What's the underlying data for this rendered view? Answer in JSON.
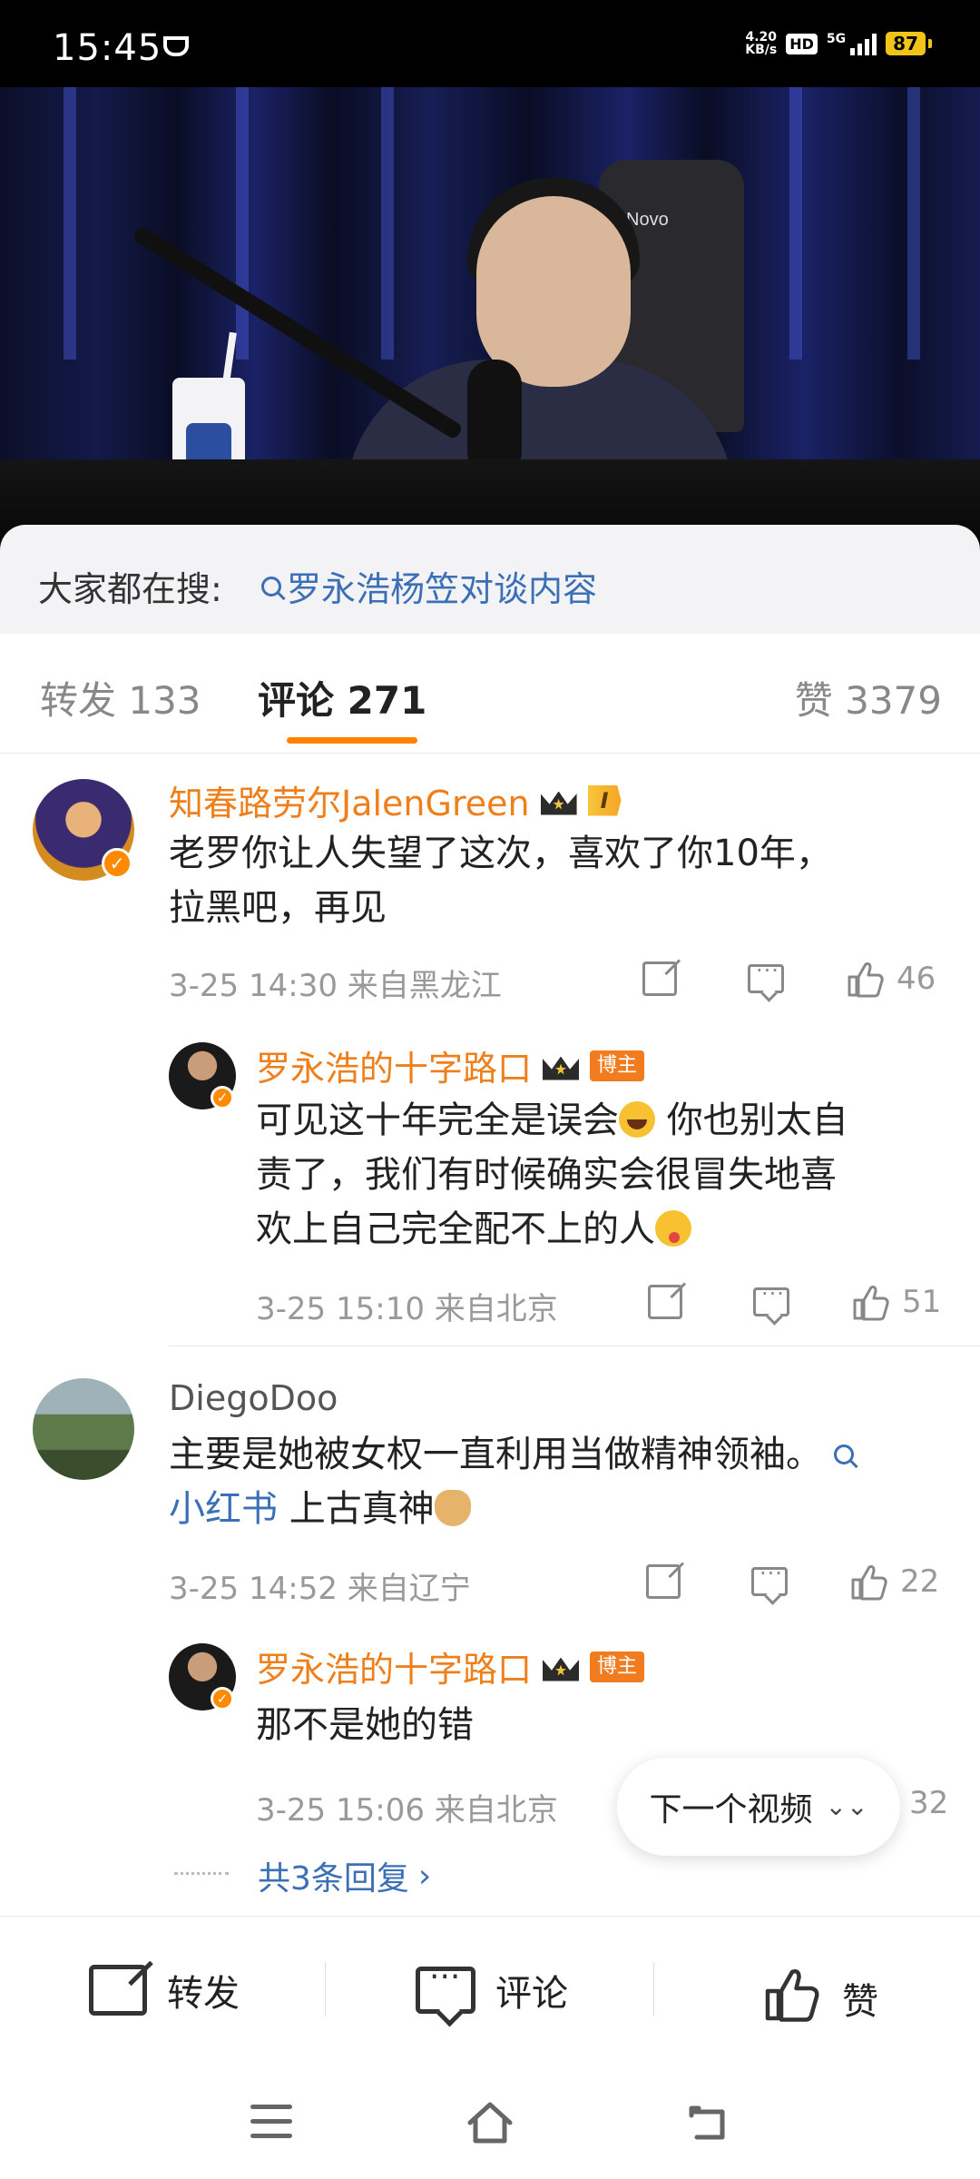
{
  "status_bar": {
    "time": "15:45",
    "net_speed_value": "4.20",
    "net_speed_unit": "KB/s",
    "hd": "HD",
    "network": "5G",
    "battery": "87"
  },
  "video": {
    "chair_brand": "Novo"
  },
  "search_suggest": {
    "label": "大家都在搜:",
    "query": "罗永浩杨笠对谈内容"
  },
  "tabs": {
    "repost": "转发 133",
    "comment": "评论 271",
    "likes": "赞 3379"
  },
  "comments": [
    {
      "username": "知春路劳尔JalenGreen",
      "level": "I",
      "text_line1": "老罗你让人失望了这次，喜欢了你10年，",
      "text_line2": "拉黑吧，再见",
      "meta": "3-25 14:30  来自黑龙江",
      "likes": "46",
      "reply": {
        "username": "罗永浩的十字路口",
        "badge": "博主",
        "text_line1": "可见这十年完全是误会",
        "text_line1_after": " 你也别太自",
        "text_line2": "责了，我们有时候确实会很冒失地喜",
        "text_line3": "欢上自己完全配不上的人",
        "meta": "3-25 15:10  来自北京",
        "likes": "51"
      }
    },
    {
      "username": "DiegoDoo",
      "text_line1": "主要是她被女权一直利用当做精神领袖。",
      "link": "小红书",
      "text_line2": " 上古真神",
      "meta": "3-25 14:52  来自辽宁",
      "likes": "22",
      "reply": {
        "username": "罗永浩的十字路口",
        "badge": "博主",
        "text": "那不是她的错",
        "meta": "3-25 15:06  来自北京",
        "likes": "32"
      },
      "more_replies": "共3条回复"
    }
  ],
  "next_video": "下一个视频",
  "bottom_bar": {
    "repost": "转发",
    "comment": "评论",
    "like": "赞"
  },
  "colors": {
    "accent": "#ff8200",
    "username": "#ef7f1a",
    "link": "#3b6fb6"
  }
}
